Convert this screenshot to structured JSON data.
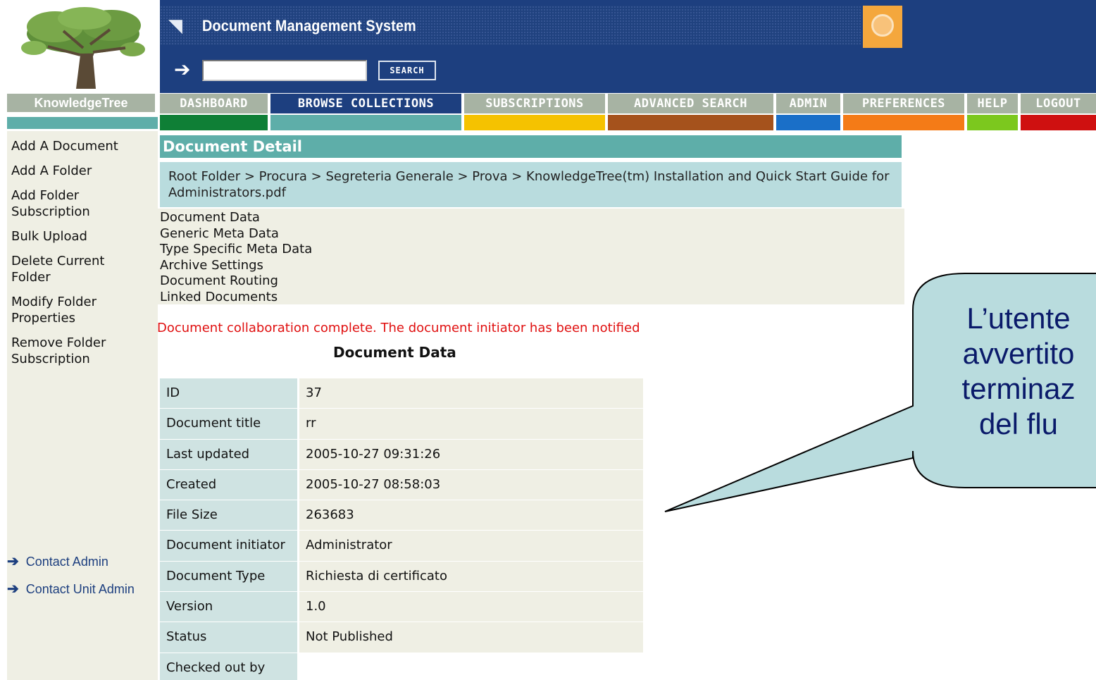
{
  "header": {
    "app_title": "Document Management System",
    "brand": "KnowledgeTree"
  },
  "search": {
    "value": "",
    "button_label": "SEARCH"
  },
  "nav": {
    "items": [
      {
        "label": "DASHBOARD",
        "color": "#0f7f36"
      },
      {
        "label": "BROWSE COLLECTIONS",
        "color": "#5eaea9"
      },
      {
        "label": "SUBSCRIPTIONS",
        "color": "#f5c200"
      },
      {
        "label": "ADVANCED SEARCH",
        "color": "#a5521c"
      },
      {
        "label": "ADMIN",
        "color": "#1a6fc8"
      },
      {
        "label": "PREFERENCES",
        "color": "#f47b17"
      },
      {
        "label": "HELP",
        "color": "#7cc81e"
      },
      {
        "label": "LOGOUT",
        "color": "#cf1010"
      }
    ],
    "active": "BROWSE COLLECTIONS"
  },
  "sidebar": {
    "links": [
      "Add A Document",
      "Add A Folder",
      "Add Folder Subscription",
      "Bulk Upload",
      "Delete Current Folder",
      "Modify Folder Properties",
      "Remove Folder Subscription"
    ],
    "contact_admin": "Contact Admin",
    "contact_unit_admin": "Contact Unit Admin"
  },
  "main": {
    "heading": "Document Detail",
    "breadcrumb": "Root Folder > Procura > Segreteria Generale > Prova > KnowledgeTree(tm) Installation and Quick Start Guide for Administrators.pdf",
    "tabs": [
      "Document Data",
      "Generic Meta Data",
      "Type Specific Meta Data",
      "Archive Settings",
      "Document Routing",
      "Linked Documents"
    ],
    "notice": "Document collaboration complete. The document initiator has been notified",
    "data_title": "Document Data",
    "rows": [
      {
        "key": "ID",
        "value": "37"
      },
      {
        "key": "Document title",
        "value": "rr"
      },
      {
        "key": "Last updated",
        "value": "2005-10-27 09:31:26"
      },
      {
        "key": "Created",
        "value": "2005-10-27 08:58:03"
      },
      {
        "key": "File Size",
        "value": "263683"
      },
      {
        "key": "Document initiator",
        "value": "Administrator"
      },
      {
        "key": "Document Type",
        "value": "Richiesta di certificato"
      },
      {
        "key": "Version",
        "value": "1.0"
      },
      {
        "key": "Status",
        "value": "Not Published"
      },
      {
        "key": "Checked out by",
        "value": ""
      }
    ]
  },
  "callout": {
    "lines": [
      "L’utente",
      "avvertito",
      "terminaz",
      "del flu"
    ]
  }
}
